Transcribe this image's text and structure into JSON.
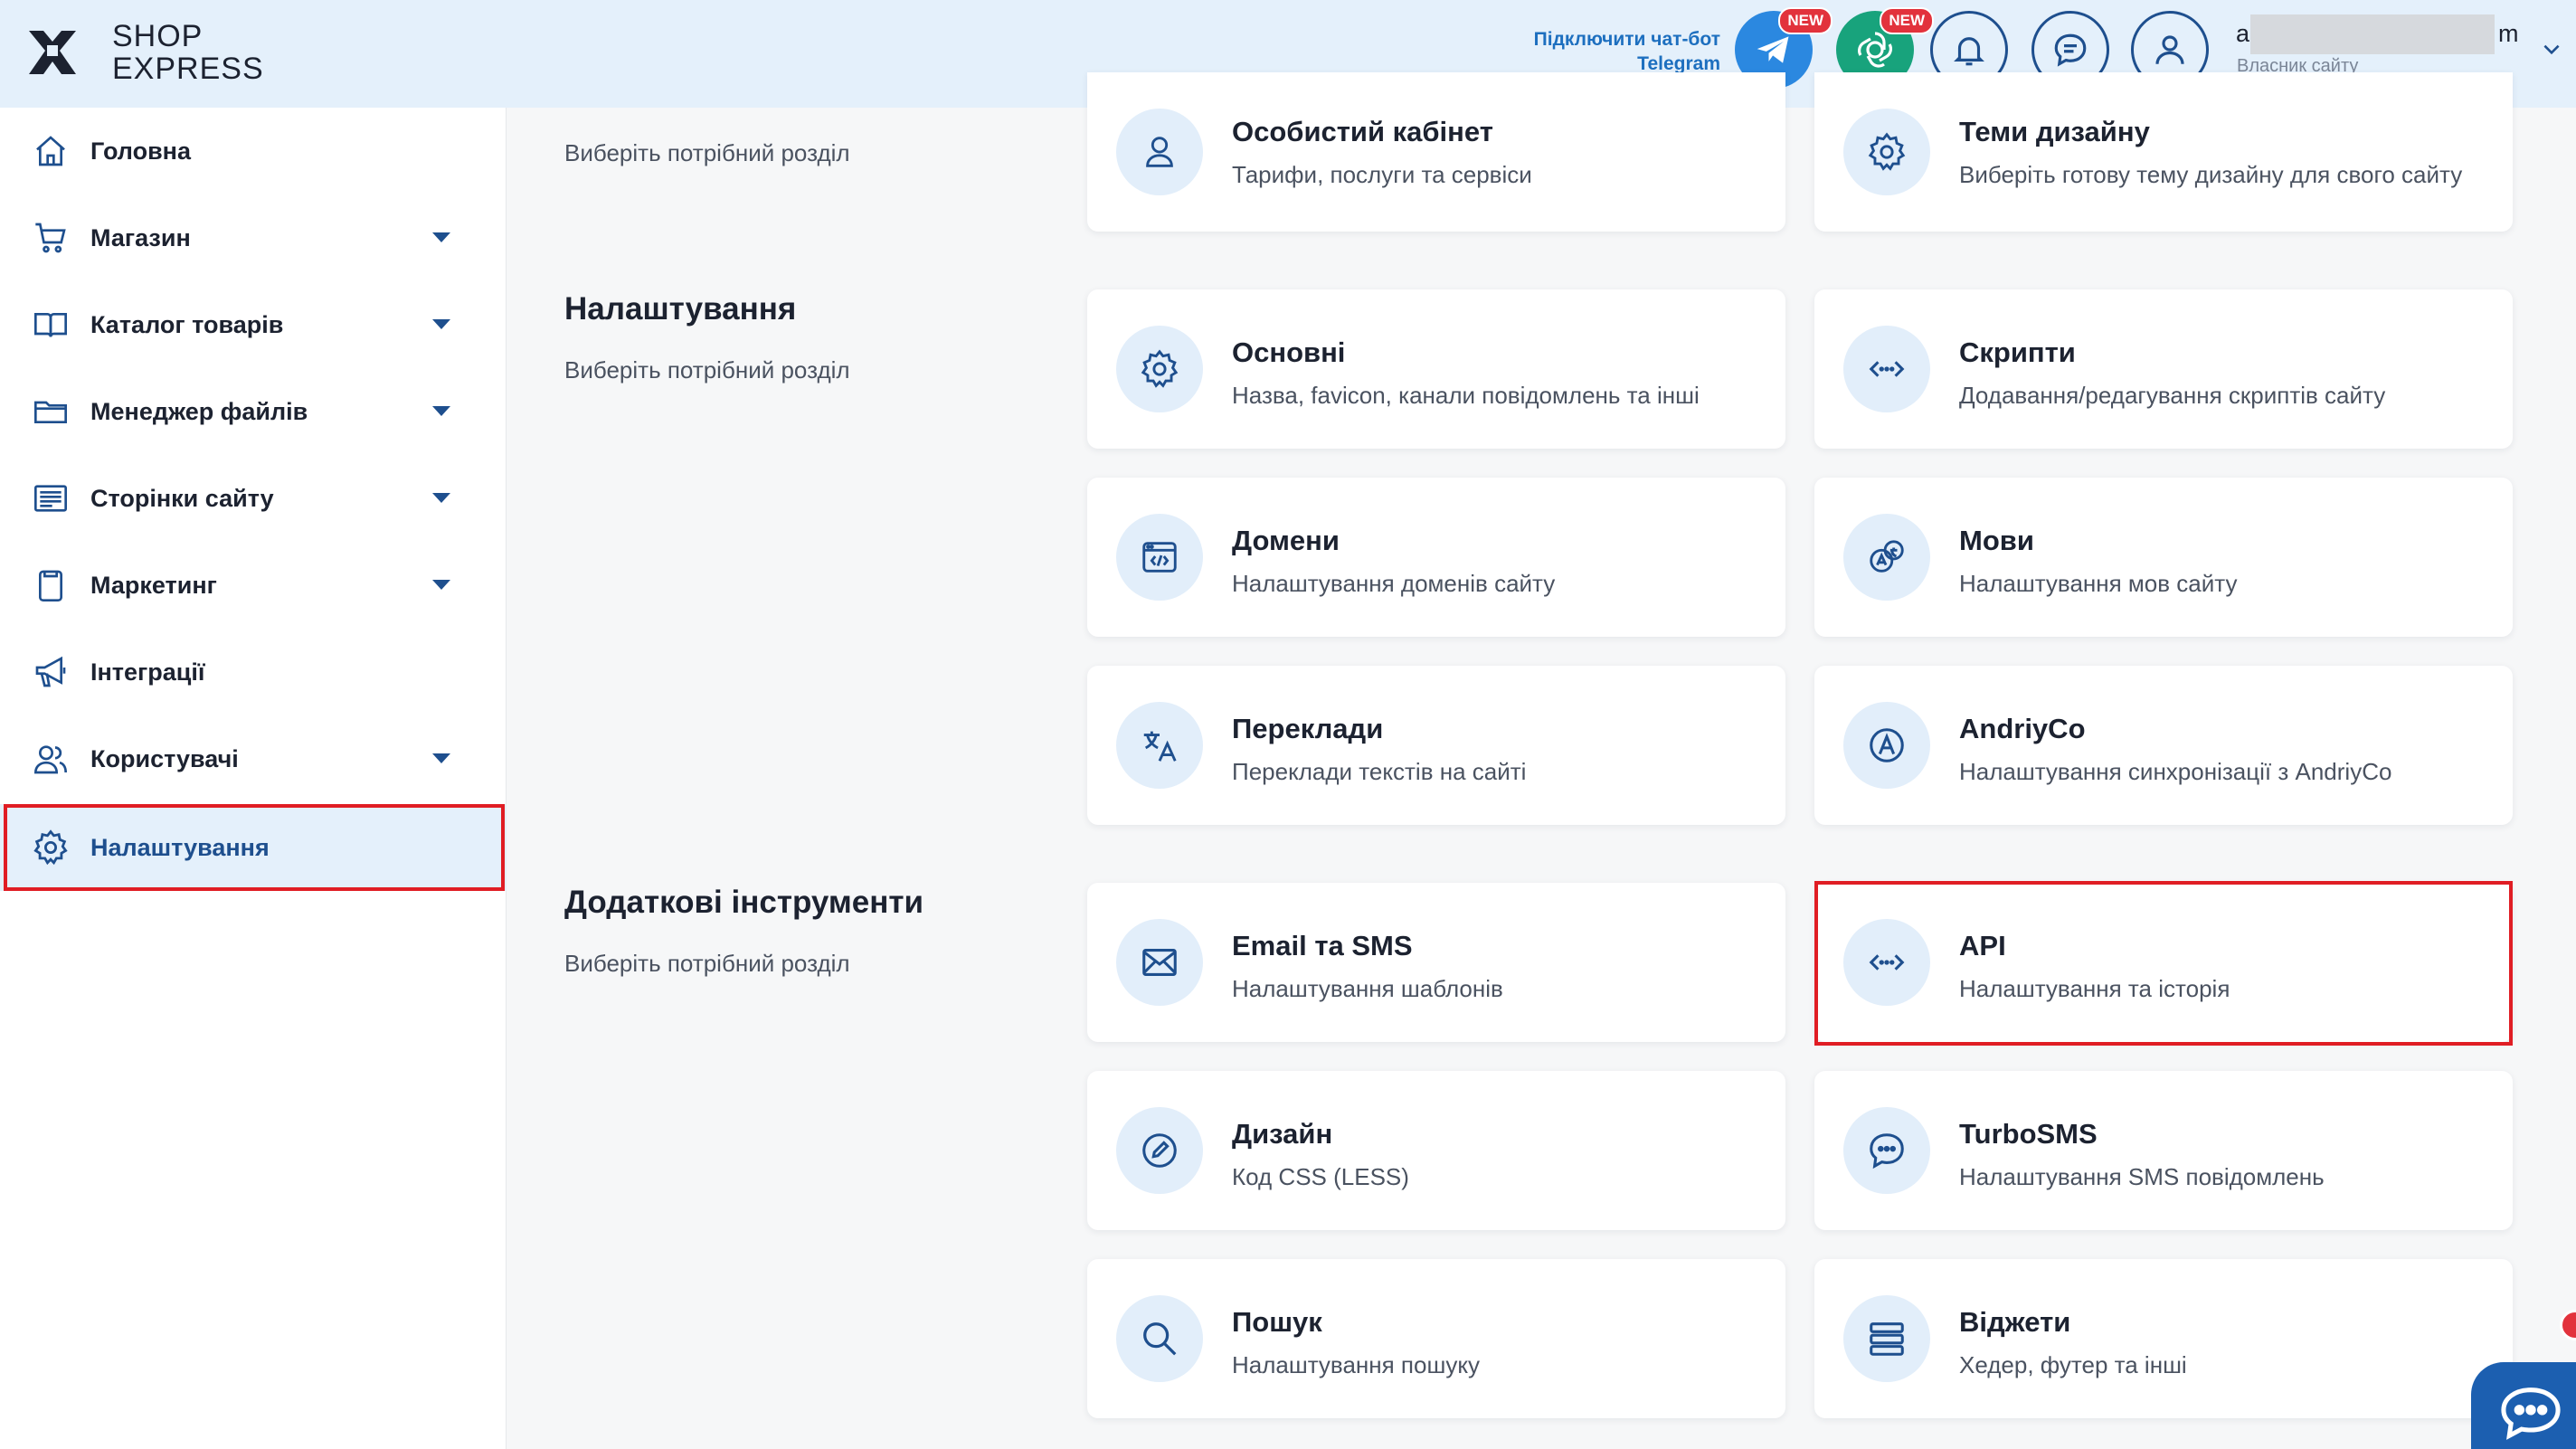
{
  "brand": {
    "line1": "SHOP",
    "line2": "EXPRESS"
  },
  "header": {
    "telegram_link_line1": "Підключити чат-бот",
    "telegram_link_line2": "Telegram",
    "new_badge": "NEW",
    "user_name_start": "a",
    "user_name_end": "m",
    "user_role": "Власник сайту"
  },
  "sidebar": {
    "items": [
      {
        "label": "Головна",
        "icon": "home-icon",
        "has_caret": false
      },
      {
        "label": "Магазин",
        "icon": "cart-icon",
        "has_caret": true
      },
      {
        "label": "Каталог товарів",
        "icon": "book-icon",
        "has_caret": true
      },
      {
        "label": "Менеджер файлів",
        "icon": "folder-icon",
        "has_caret": true
      },
      {
        "label": "Сторінки сайту",
        "icon": "pages-icon",
        "has_caret": true
      },
      {
        "label": "Маркетинг",
        "icon": "clipboard-icon",
        "has_caret": true
      },
      {
        "label": "Інтеграції",
        "icon": "megaphone-icon",
        "has_caret": false
      },
      {
        "label": "Користувачі",
        "icon": "users-icon",
        "has_caret": true
      },
      {
        "label": "Налаштування",
        "icon": "gear-icon",
        "has_caret": false,
        "active": true
      }
    ]
  },
  "main": {
    "top_section": {
      "subtitle": "Виберіть потрібний розділ"
    },
    "settings_section": {
      "title": "Налаштування",
      "subtitle": "Виберіть потрібний розділ"
    },
    "tools_section": {
      "title": "Додаткові інструменти",
      "subtitle": "Виберіть потрібний розділ"
    },
    "cards": [
      {
        "title": "Особистий кабінет",
        "desc": "Тарифи, послуги та сервіси",
        "icon": "user-icon"
      },
      {
        "title": "Теми дизайну",
        "desc": "Виберіть готову тему дизайну для свого сайту",
        "icon": "gear-icon"
      },
      {
        "title": "Основні",
        "desc": "Назва, favicon, канали повідомлень та інші",
        "icon": "gear-icon"
      },
      {
        "title": "Скрипти",
        "desc": "Додавання/редагування скриптів сайту",
        "icon": "code-icon"
      },
      {
        "title": "Домени",
        "desc": "Налаштування доменів сайту",
        "icon": "browser-code-icon"
      },
      {
        "title": "Мови",
        "desc": "Налаштування мов сайту",
        "icon": "languages-icon"
      },
      {
        "title": "Переклади",
        "desc": "Переклади текстів на сайті",
        "icon": "translate-icon"
      },
      {
        "title": "AndriyCo",
        "desc": "Налаштування синхронізації з AndriyCo",
        "icon": "andriyco-icon"
      },
      {
        "title": "Email та SMS",
        "desc": "Налаштування шаблонів",
        "icon": "envelope-icon"
      },
      {
        "title": "API",
        "desc": "Налаштування та історія",
        "icon": "code-icon"
      },
      {
        "title": "Дизайн",
        "desc": "Код CSS (LESS)",
        "icon": "pen-icon"
      },
      {
        "title": "TurboSMS",
        "desc": "Налаштування SMS повідомлень",
        "icon": "chat-dots-icon"
      },
      {
        "title": "Пошук",
        "desc": "Налаштування пошуку",
        "icon": "search-icon"
      },
      {
        "title": "Віджети",
        "desc": "Хедер, футер та інші",
        "icon": "widgets-icon"
      }
    ]
  },
  "colors": {
    "accent": "#1e4f8e",
    "header_bg": "#e4f0fb",
    "highlight": "#e01d24",
    "icon_bg": "#e2eefa"
  }
}
